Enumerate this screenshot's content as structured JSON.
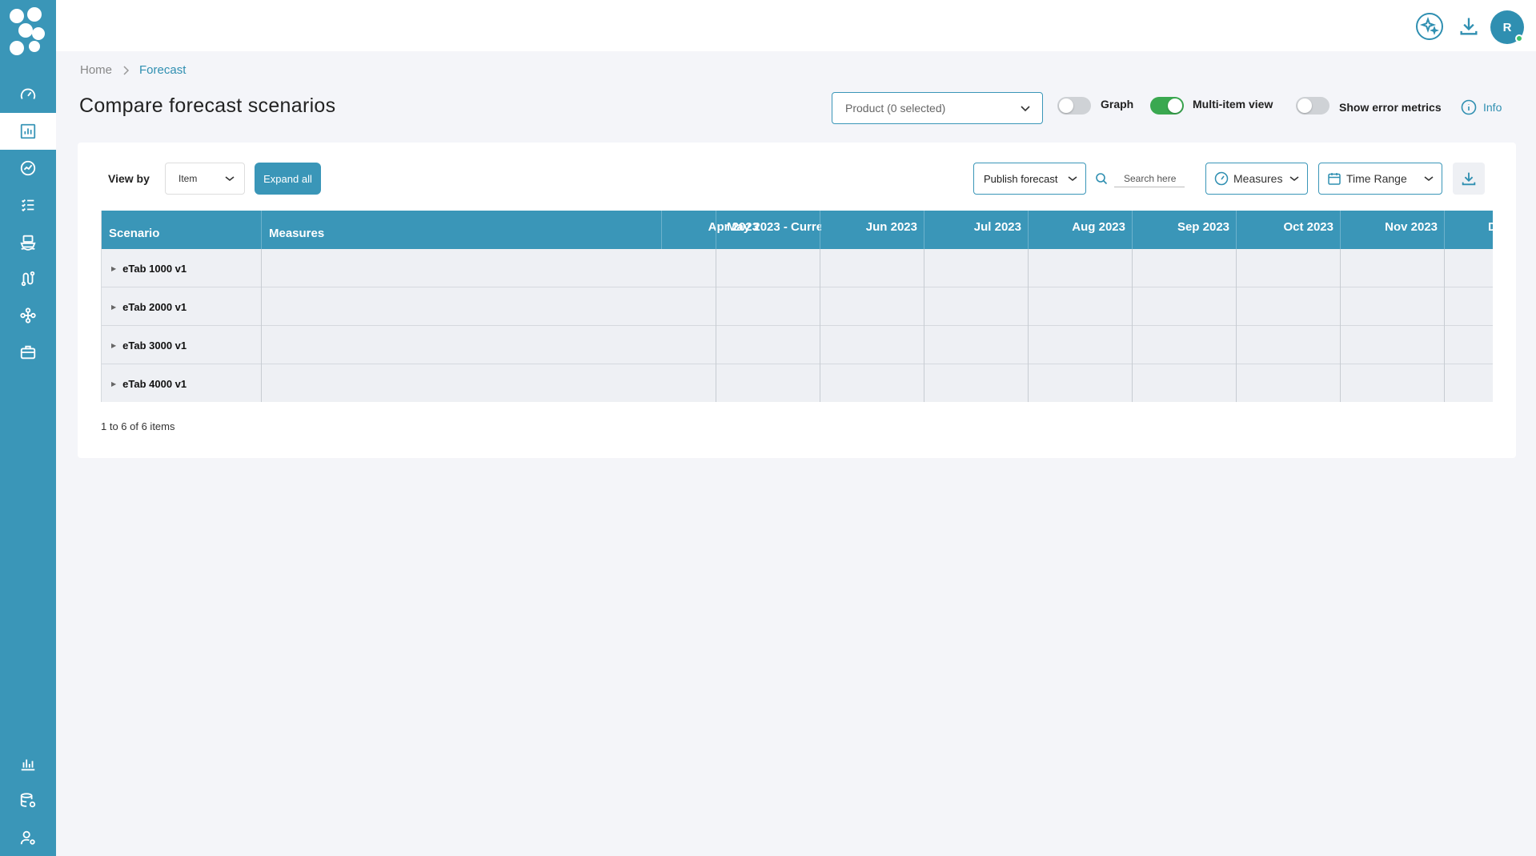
{
  "user": {
    "initial": "R"
  },
  "breadcrumb": {
    "home": "Home",
    "current": "Forecast"
  },
  "page": {
    "title": "Compare forecast scenarios"
  },
  "filters": {
    "product_select": "Product (0 selected)",
    "graph_label": "Graph",
    "graph_on": false,
    "multi_item_label": "Multi-item view",
    "multi_item_on": true,
    "error_metrics_label": "Show error metrics",
    "error_metrics_on": false,
    "info_label": "Info"
  },
  "toolbar": {
    "view_by_label": "View by",
    "view_by_value": "Item",
    "expand_all_label": "Expand all",
    "publish_label": "Publish forecast",
    "search_placeholder": "Search here",
    "measures_label": "Measures",
    "time_range_label": "Time Range"
  },
  "grid": {
    "col_scenario": "Scenario",
    "col_measures": "Measures",
    "months": [
      "Apr 2023",
      "May 2023 - Curre",
      "Jun 2023",
      "Jul 2023",
      "Aug 2023",
      "Sep 2023",
      "Oct 2023",
      "Nov 2023",
      "D"
    ],
    "rows": [
      "eTab 1000 v1",
      "eTab 2000 v1",
      "eTab 3000 v1",
      "eTab 4000 v1"
    ]
  },
  "pager": {
    "text": "1 to 6 of 6 items"
  },
  "colors": {
    "primary": "#3a96b8",
    "toggle_on": "#3aa850",
    "background": "#f4f5f9"
  }
}
